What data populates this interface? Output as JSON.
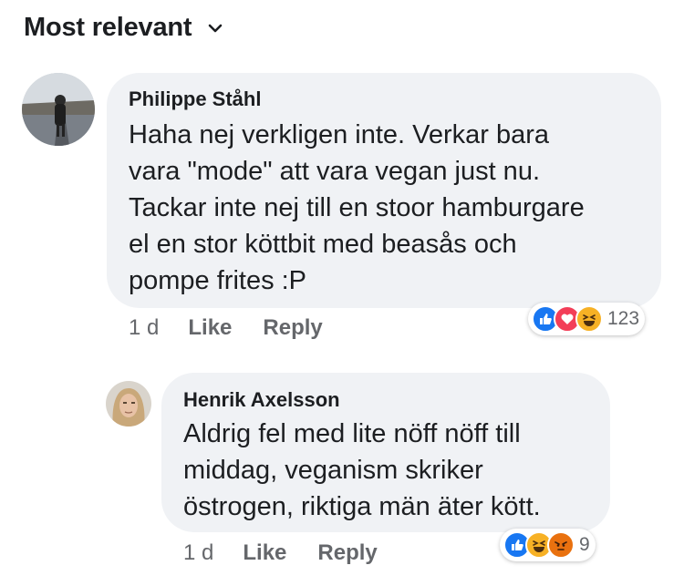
{
  "sort": {
    "label": "Most relevant"
  },
  "comments": [
    {
      "author": "Philippe Ståhl",
      "text": "Haha nej verkligen inte. Verkar bara\nvara \"mode\" att vara vegan just nu.\nTackar inte nej till en stoor hamburgare\nel en stor köttbit med beasås och\npompe frites :P",
      "time": "1 d",
      "like": "Like",
      "reply": "Reply",
      "reaction_count": "123",
      "reactions": [
        "like-reaction-icon",
        "love-reaction-icon",
        "haha-reaction-icon"
      ]
    },
    {
      "author": "Henrik Axelsson",
      "text": "Aldrig fel med lite nöff nöff till\nmiddag, veganism skriker\nöstrogen, riktiga män äter kött.",
      "time": "1 d",
      "like": "Like",
      "reply": "Reply",
      "reaction_count": "9",
      "reactions": [
        "like-reaction-icon",
        "haha-reaction-icon",
        "angry-reaction-icon"
      ]
    }
  ],
  "colors": {
    "like": "#1877f2",
    "love": "#f33e58",
    "haha": "#f7b125",
    "angry": "#e9710f",
    "bubble": "#f0f2f5",
    "meta": "#65676b"
  }
}
